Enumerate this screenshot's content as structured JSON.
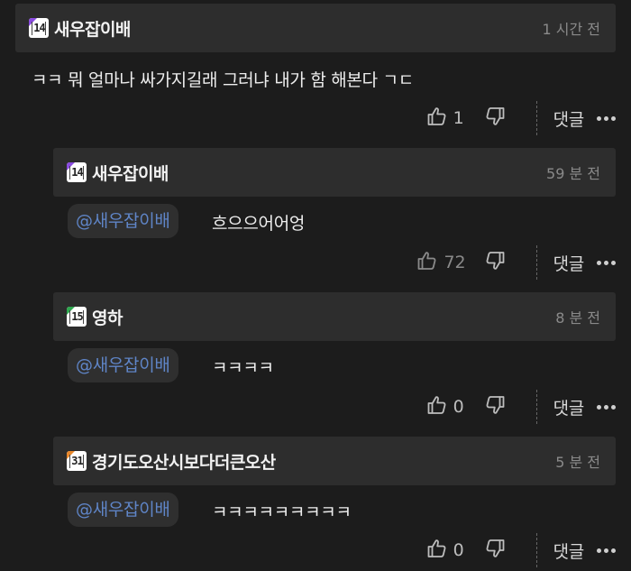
{
  "comments": [
    {
      "badge": {
        "level": "14",
        "color": "#8a4be0"
      },
      "author": "새우잡이배",
      "time": "1 시간 전",
      "mention": "",
      "text": "ㅋㅋ 뭐 얼마나 싸가지길래 그러냐 내가 함 해본다 ㄱㄷ",
      "likes": "1",
      "reply_label": "댓글"
    },
    {
      "badge": {
        "level": "14",
        "color": "#8a4be0"
      },
      "author": "새우잡이배",
      "time": "59 분 전",
      "mention": "@새우잡이배",
      "text": "흐으으어어엉",
      "likes": "72",
      "reply_label": "댓글"
    },
    {
      "badge": {
        "level": "15",
        "color": "#2fa84f"
      },
      "author": "영하",
      "time": "8 분 전",
      "mention": "@새우잡이배",
      "text": "ㅋㅋㅋㅋ",
      "likes": "0",
      "reply_label": "댓글"
    },
    {
      "badge": {
        "level": "31",
        "color": "#e8872b"
      },
      "author": "경기도오산시보다더큰오산",
      "time": "5 분 전",
      "mention": "@새우잡이배",
      "text": "ㅋㅋㅋㅋㅋㅋㅋㅋㅋ",
      "likes": "0",
      "reply_label": "댓글"
    }
  ],
  "icons": {
    "like": "thumbs-up-icon",
    "dislike": "thumbs-down-icon",
    "more": "more-dots-icon"
  }
}
